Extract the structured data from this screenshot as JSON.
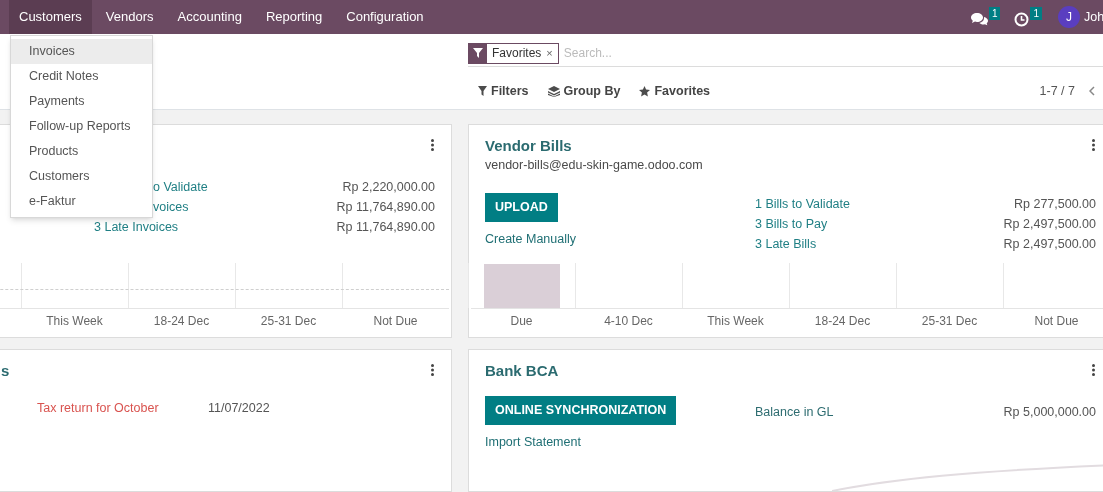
{
  "navbar": {
    "menu": [
      {
        "label": "Customers",
        "selected": true
      },
      {
        "label": "Vendors",
        "selected": false
      },
      {
        "label": "Accounting",
        "selected": false
      },
      {
        "label": "Reporting",
        "selected": false
      },
      {
        "label": "Configuration",
        "selected": false
      }
    ],
    "systray": [
      {
        "kind": "chat",
        "badge": "1"
      },
      {
        "kind": "activity",
        "badge": "1"
      }
    ],
    "user": {
      "initial": "J",
      "name": "Joh"
    }
  },
  "dropdown": {
    "items": [
      {
        "label": "Invoices",
        "selected": true
      },
      {
        "label": "Credit Notes",
        "selected": false
      },
      {
        "label": "Payments",
        "selected": false
      },
      {
        "label": "Follow-up Reports",
        "selected": false
      },
      {
        "label": "Products",
        "selected": false
      },
      {
        "label": "Customers",
        "selected": false
      },
      {
        "label": "e-Faktur",
        "selected": false
      }
    ]
  },
  "search": {
    "facet": "Favorites",
    "remove": "×",
    "placeholder": "Search..."
  },
  "toolbar": [
    {
      "kind": "filter",
      "label": "Filters"
    },
    {
      "kind": "layers",
      "label": "Group By"
    },
    {
      "kind": "star",
      "label": "Favorites"
    }
  ],
  "pager": "1-7 / 7",
  "columns": [
    [
      {
        "kind": "journal",
        "stats": [
          {
            "label": "o Validate",
            "amount": "Rp 2,220,000.00",
            "kind": "clipped"
          },
          {
            "label": "voices",
            "amount": "Rp 11,764,890.00",
            "kind": "clipped"
          },
          {
            "label": "3 Late Invoices",
            "amount": "Rp 11,764,890.00",
            "kind": "link"
          }
        ],
        "chart": {
          "baseline": true,
          "columns": [
            {
              "label": "This Week",
              "bar": false
            },
            {
              "label": "18-24 Dec",
              "bar": false
            },
            {
              "label": "25-31 Dec",
              "bar": false
            },
            {
              "label": "Not Due",
              "bar": false
            }
          ]
        }
      },
      {
        "kind": "activities",
        "title": "s",
        "title_clipped": true,
        "activities": [
          {
            "label": "Tax return for October",
            "date": "11/07/2022"
          }
        ]
      }
    ],
    [
      {
        "kind": "journal",
        "title": "Vendor Bills",
        "email": "vendor-bills@edu-skin-game.odoo.com",
        "button": "UPLOAD",
        "link": "Create Manually",
        "stats": [
          {
            "label": "1 Bills to Validate",
            "amount": "Rp 277,500.00",
            "kind": "link"
          },
          {
            "label": "3 Bills to Pay",
            "amount": "Rp 2,497,500.00",
            "kind": "link"
          },
          {
            "label": "3 Late Bills",
            "amount": "Rp 2,497,500.00",
            "kind": "link"
          }
        ],
        "chart": {
          "baseline": false,
          "columns": [
            {
              "label": "Due",
              "bar": true
            },
            {
              "label": "4-10 Dec",
              "bar": false
            },
            {
              "label": "This Week",
              "bar": false
            },
            {
              "label": "18-24 Dec",
              "bar": false
            },
            {
              "label": "25-31 Dec",
              "bar": false
            },
            {
              "label": "Not Due",
              "bar": false
            }
          ]
        }
      },
      {
        "kind": "bank",
        "title": "Bank BCA",
        "button": "ONLINE SYNCHRONIZATION",
        "link": "Import Statement",
        "stats": [
          {
            "label": "Balance in GL",
            "amount": "Rp 5,000,000.00",
            "kind": "plain"
          }
        ],
        "sparkline": true
      }
    ]
  ]
}
